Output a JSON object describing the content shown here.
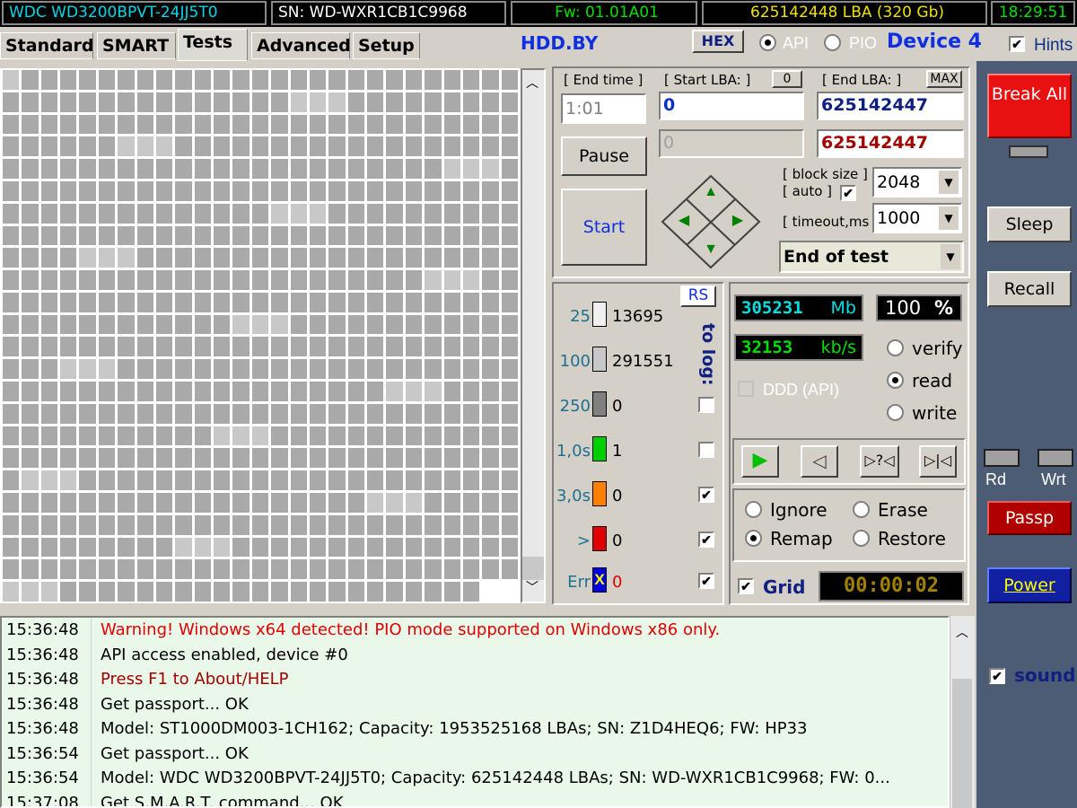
{
  "topbar": {
    "model": "WDC WD3200BPVT-24JJ5T0",
    "serial": "SN: WD-WXR1CB1C9968",
    "firmware": "Fw: 01.01A01",
    "capacity": "625142448 LBA (320 Gb)",
    "time": "18:29:51"
  },
  "tabs": [
    "Standard",
    "SMART",
    "Tests",
    "Advanced",
    "Setup"
  ],
  "header": {
    "brand": "HDD.BY",
    "hex_label": "HEX",
    "api_label": "API",
    "pio_label": "PIO",
    "device_label": "Device 4",
    "hints_label": "Hints"
  },
  "controls": {
    "end_time_label": "[ End time ]",
    "end_time_value": "1:01",
    "start_lba_label": "[ Start LBA: ]",
    "start_lba_zero": "0",
    "start_lba_value": "0",
    "start_lba_current": "0",
    "end_lba_label": "[ End LBA: ]",
    "end_lba_max": "MAX",
    "end_lba_value": "625142447",
    "end_lba_current": "625142447",
    "pause_label": "Pause",
    "start_label": "Start",
    "block_size_label": "[ block size ]",
    "auto_label": "[ auto ]",
    "block_size_value": "2048",
    "timeout_label": "[ timeout,ms ]",
    "timeout_value": "1000",
    "end_action_value": "End of test"
  },
  "stats": {
    "rs_label": "RS",
    "to_log_label": "to log:",
    "rows": [
      {
        "label": "25",
        "count": "13695",
        "color": "#f0f0f0"
      },
      {
        "label": "100",
        "count": "291551",
        "color": "#c8c8c8"
      },
      {
        "label": "250",
        "count": "0",
        "color": "#808080"
      },
      {
        "label": "1,0s",
        "count": "1",
        "color": "#00d000"
      },
      {
        "label": "3,0s",
        "count": "0",
        "color": "#ff8000"
      },
      {
        "label": ">",
        "count": "0",
        "color": "#e00000"
      },
      {
        "label": "Err",
        "count": "0",
        "color": "#0000e0"
      }
    ],
    "err_glyph": "X"
  },
  "readout": {
    "mb_value": "305231",
    "mb_unit": "Mb",
    "percent_value": "100",
    "percent_unit": "%",
    "speed_value": "32153",
    "speed_unit": "kb/s",
    "ddd_label": "DDD (API)",
    "verify_label": "verify",
    "read_label": "read",
    "write_label": "write",
    "ignore_label": "Ignore",
    "erase_label": "Erase",
    "remap_label": "Remap",
    "restore_label": "Restore",
    "grid_label": "Grid",
    "elapsed": "00:00:02"
  },
  "sidebar": {
    "break_all": "Break All",
    "sleep": "Sleep",
    "recall": "Recall",
    "rd": "Rd",
    "wrt": "Wrt",
    "passp": "Passp",
    "power": "Power",
    "sound": "sound"
  },
  "log": [
    {
      "time": "15:36:48",
      "msg": "Warning! Windows x64 detected! PIO mode supported on Windows x86 only.",
      "color": "#e00000"
    },
    {
      "time": "15:36:48",
      "msg": "API access enabled, device #0",
      "color": "#000000"
    },
    {
      "time": "15:36:48",
      "msg": "Press F1 to About/HELP",
      "color": "#a00000"
    },
    {
      "time": "15:36:48",
      "msg": "Get passport... OK",
      "color": "#000000"
    },
    {
      "time": "15:36:48",
      "msg": "Model: ST1000DM003-1CH162; Capacity: 1953525168 LBAs; SN: Z1D4HEQ6; FW: HP33",
      "color": "#000000"
    },
    {
      "time": "15:36:54",
      "msg": "Get passport... OK",
      "color": "#000000"
    },
    {
      "time": "15:36:54",
      "msg": "Model: WDC WD3200BPVT-24JJ5T0; Capacity: 625142448 LBAs; SN: WD-WXR1CB1C9968; FW: 0...",
      "color": "#000000"
    },
    {
      "time": "15:37:08",
      "msg": "Get S.M.A.R.T. command... OK",
      "color": "#000000"
    }
  ],
  "colors": {
    "accent_blue": "#0000ff",
    "break_red": "#e81010",
    "sidebar_bg": "#4c5c74",
    "lcd_cyan": "#00e0e0",
    "lcd_green": "#00e000"
  }
}
